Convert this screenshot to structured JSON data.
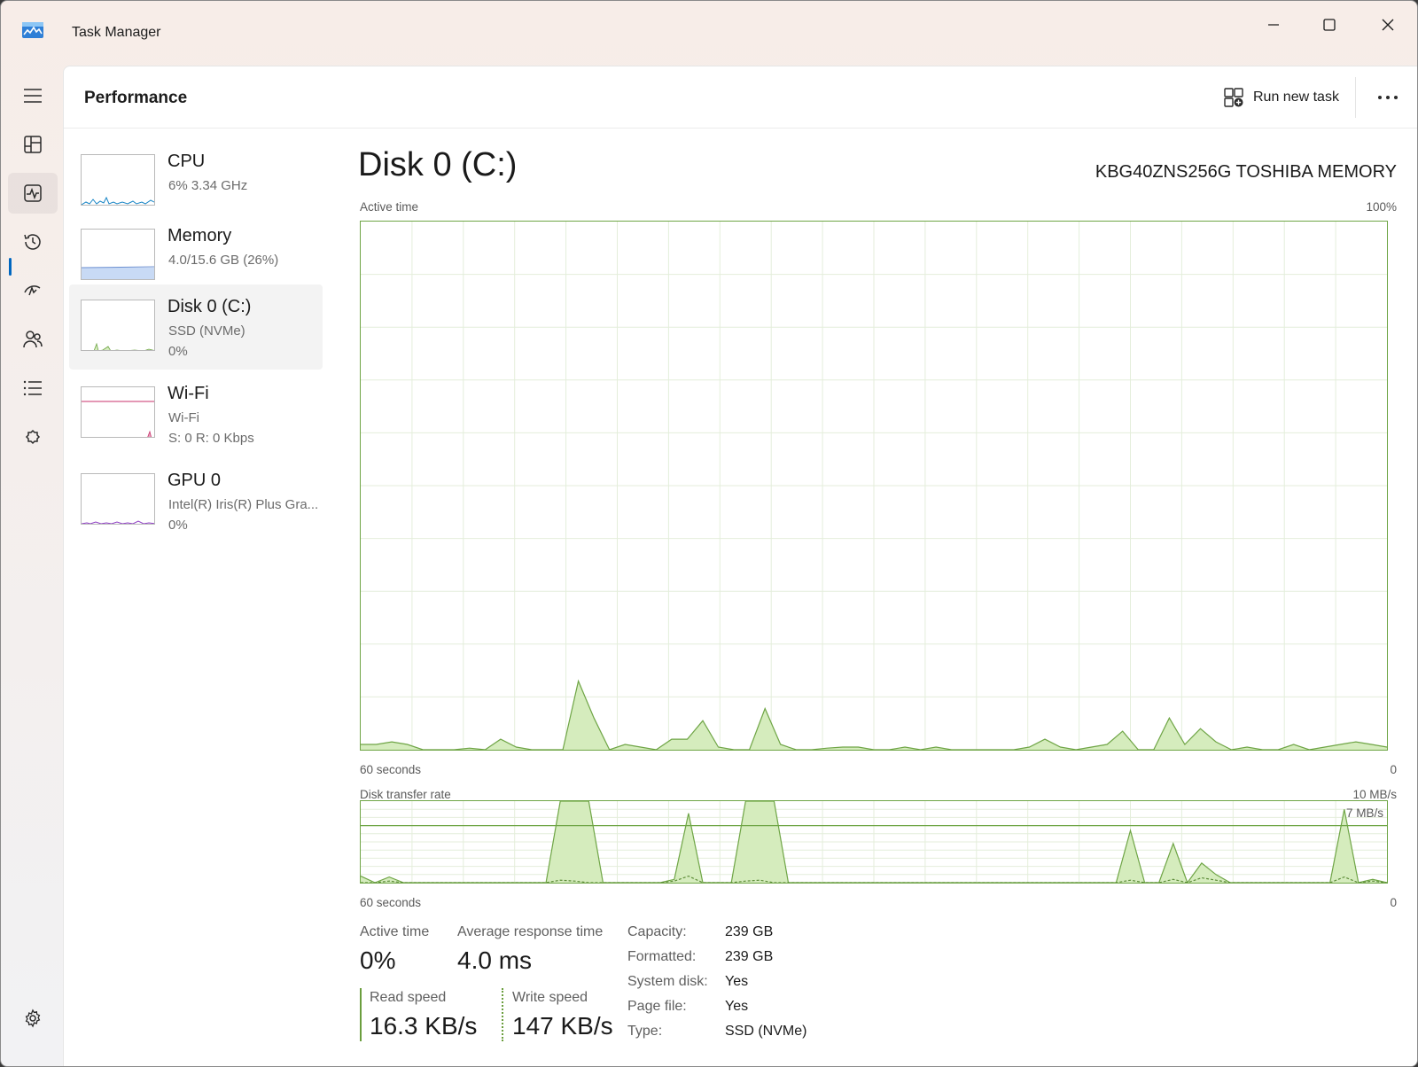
{
  "window": {
    "title": "Task Manager"
  },
  "nav": {
    "items": [
      {
        "icon": "hamburger-menu-icon"
      },
      {
        "icon": "processes-icon"
      },
      {
        "icon": "performance-icon",
        "active": true
      },
      {
        "icon": "app-history-icon"
      },
      {
        "icon": "startup-apps-icon"
      },
      {
        "icon": "users-icon"
      },
      {
        "icon": "details-icon"
      },
      {
        "icon": "services-icon"
      },
      {
        "icon": "settings-icon"
      }
    ]
  },
  "cmdbar": {
    "title": "Performance",
    "run_new_task": "Run new task",
    "more_icon": "ellipsis-icon"
  },
  "resources": [
    {
      "name": "CPU",
      "sub1": "6%  3.34 GHz",
      "sub2": "",
      "color": "#1a86c6"
    },
    {
      "name": "Memory",
      "sub1": "4.0/15.6 GB (26%)",
      "sub2": "",
      "color": "#6b8fd1"
    },
    {
      "name": "Disk 0 (C:)",
      "sub1": "SSD (NVMe)",
      "sub2": "0%",
      "color": "#6fa546",
      "selected": true
    },
    {
      "name": "Wi-Fi",
      "sub1": "Wi-Fi",
      "sub2": "S: 0  R: 0 Kbps",
      "color": "#c8316b"
    },
    {
      "name": "GPU 0",
      "sub1": "Intel(R) Iris(R) Plus Gra...",
      "sub2": "0%",
      "color": "#8f3fc4"
    }
  ],
  "detail": {
    "title": "Disk 0 (C:)",
    "model": "KBG40ZNS256G TOSHIBA MEMORY",
    "active_graph": {
      "label": "Active time",
      "max_label": "100%",
      "left_axis": "60 seconds",
      "right_axis": "0"
    },
    "transfer_graph": {
      "label": "Disk transfer rate",
      "max_label": "10 MB/s",
      "line_label": "7 MB/s",
      "left_axis": "60 seconds",
      "right_axis": "0"
    },
    "stats": {
      "active_time_label": "Active time",
      "active_time_value": "0%",
      "avg_response_label": "Average response time",
      "avg_response_value": "4.0 ms",
      "read_speed_label": "Read speed",
      "read_speed_value": "16.3 KB/s",
      "write_speed_label": "Write speed",
      "write_speed_value": "147 KB/s"
    },
    "properties": [
      {
        "key": "Capacity:",
        "value": "239 GB"
      },
      {
        "key": "Formatted:",
        "value": "239 GB"
      },
      {
        "key": "System disk:",
        "value": "Yes"
      },
      {
        "key": "Page file:",
        "value": "Yes"
      },
      {
        "key": "Type:",
        "value": "SSD (NVMe)"
      }
    ]
  },
  "chart_data": [
    {
      "type": "area",
      "title": "Active time",
      "ylim": [
        0,
        100
      ],
      "x_range": [
        "60 seconds",
        "0"
      ],
      "series": [
        {
          "values": [
            1,
            1,
            1.5,
            1,
            0,
            0,
            0,
            0.3,
            0,
            2,
            0.5,
            0,
            0,
            0,
            13,
            6,
            0,
            1,
            0.5,
            0,
            2,
            2,
            5.5,
            0.5,
            0,
            0,
            7.8,
            1,
            0,
            0,
            0.3,
            0.5,
            0.5,
            0,
            0,
            0.5,
            0,
            0.5,
            0,
            0,
            0,
            0,
            0,
            0.5,
            2,
            0.5,
            0,
            0.5,
            1,
            3.5,
            0,
            0,
            6,
            1,
            4,
            1.5,
            0,
            0.5,
            0,
            0,
            1,
            0,
            0.5,
            1,
            1.5,
            1,
            0.5
          ]
        }
      ]
    },
    {
      "type": "area",
      "title": "Disk transfer rate",
      "ylim": [
        0,
        10
      ],
      "reference_line": 7,
      "x_range": [
        "60 seconds",
        "0"
      ],
      "series": [
        {
          "name": "Read speed",
          "values": [
            0.8,
            0,
            0.7,
            0,
            0,
            0,
            0,
            0,
            0,
            0,
            0,
            0,
            0,
            0,
            10,
            10,
            10,
            0,
            0,
            0,
            0,
            0,
            0.4,
            8.5,
            0,
            0,
            0,
            10,
            10,
            10,
            0,
            0,
            0,
            0,
            0,
            0,
            0,
            0,
            0,
            0,
            0,
            0,
            0,
            0,
            0,
            0,
            0,
            0,
            0,
            0,
            0,
            0,
            0,
            0,
            6.4,
            0,
            0,
            4.8,
            0,
            2.4,
            1,
            0,
            0,
            0,
            0,
            0,
            0,
            0,
            0,
            9,
            0,
            0.4,
            0
          ]
        },
        {
          "name": "Write speed",
          "values": [
            0,
            0,
            0.2,
            0,
            0,
            0,
            0,
            0,
            0,
            0,
            0,
            0,
            0,
            0,
            0.3,
            0.2,
            0,
            0,
            0,
            0,
            0,
            0,
            0.2,
            0.8,
            0,
            0,
            0,
            0.2,
            0.3,
            0,
            0,
            0,
            0,
            0,
            0,
            0,
            0,
            0,
            0,
            0,
            0,
            0,
            0,
            0,
            0,
            0,
            0,
            0,
            0,
            0,
            0,
            0,
            0,
            0,
            0.3,
            0,
            0,
            0.4,
            0,
            0.6,
            0.3,
            0,
            0,
            0,
            0,
            0,
            0,
            0,
            0,
            0.7,
            0,
            0.2,
            0
          ]
        }
      ]
    }
  ]
}
